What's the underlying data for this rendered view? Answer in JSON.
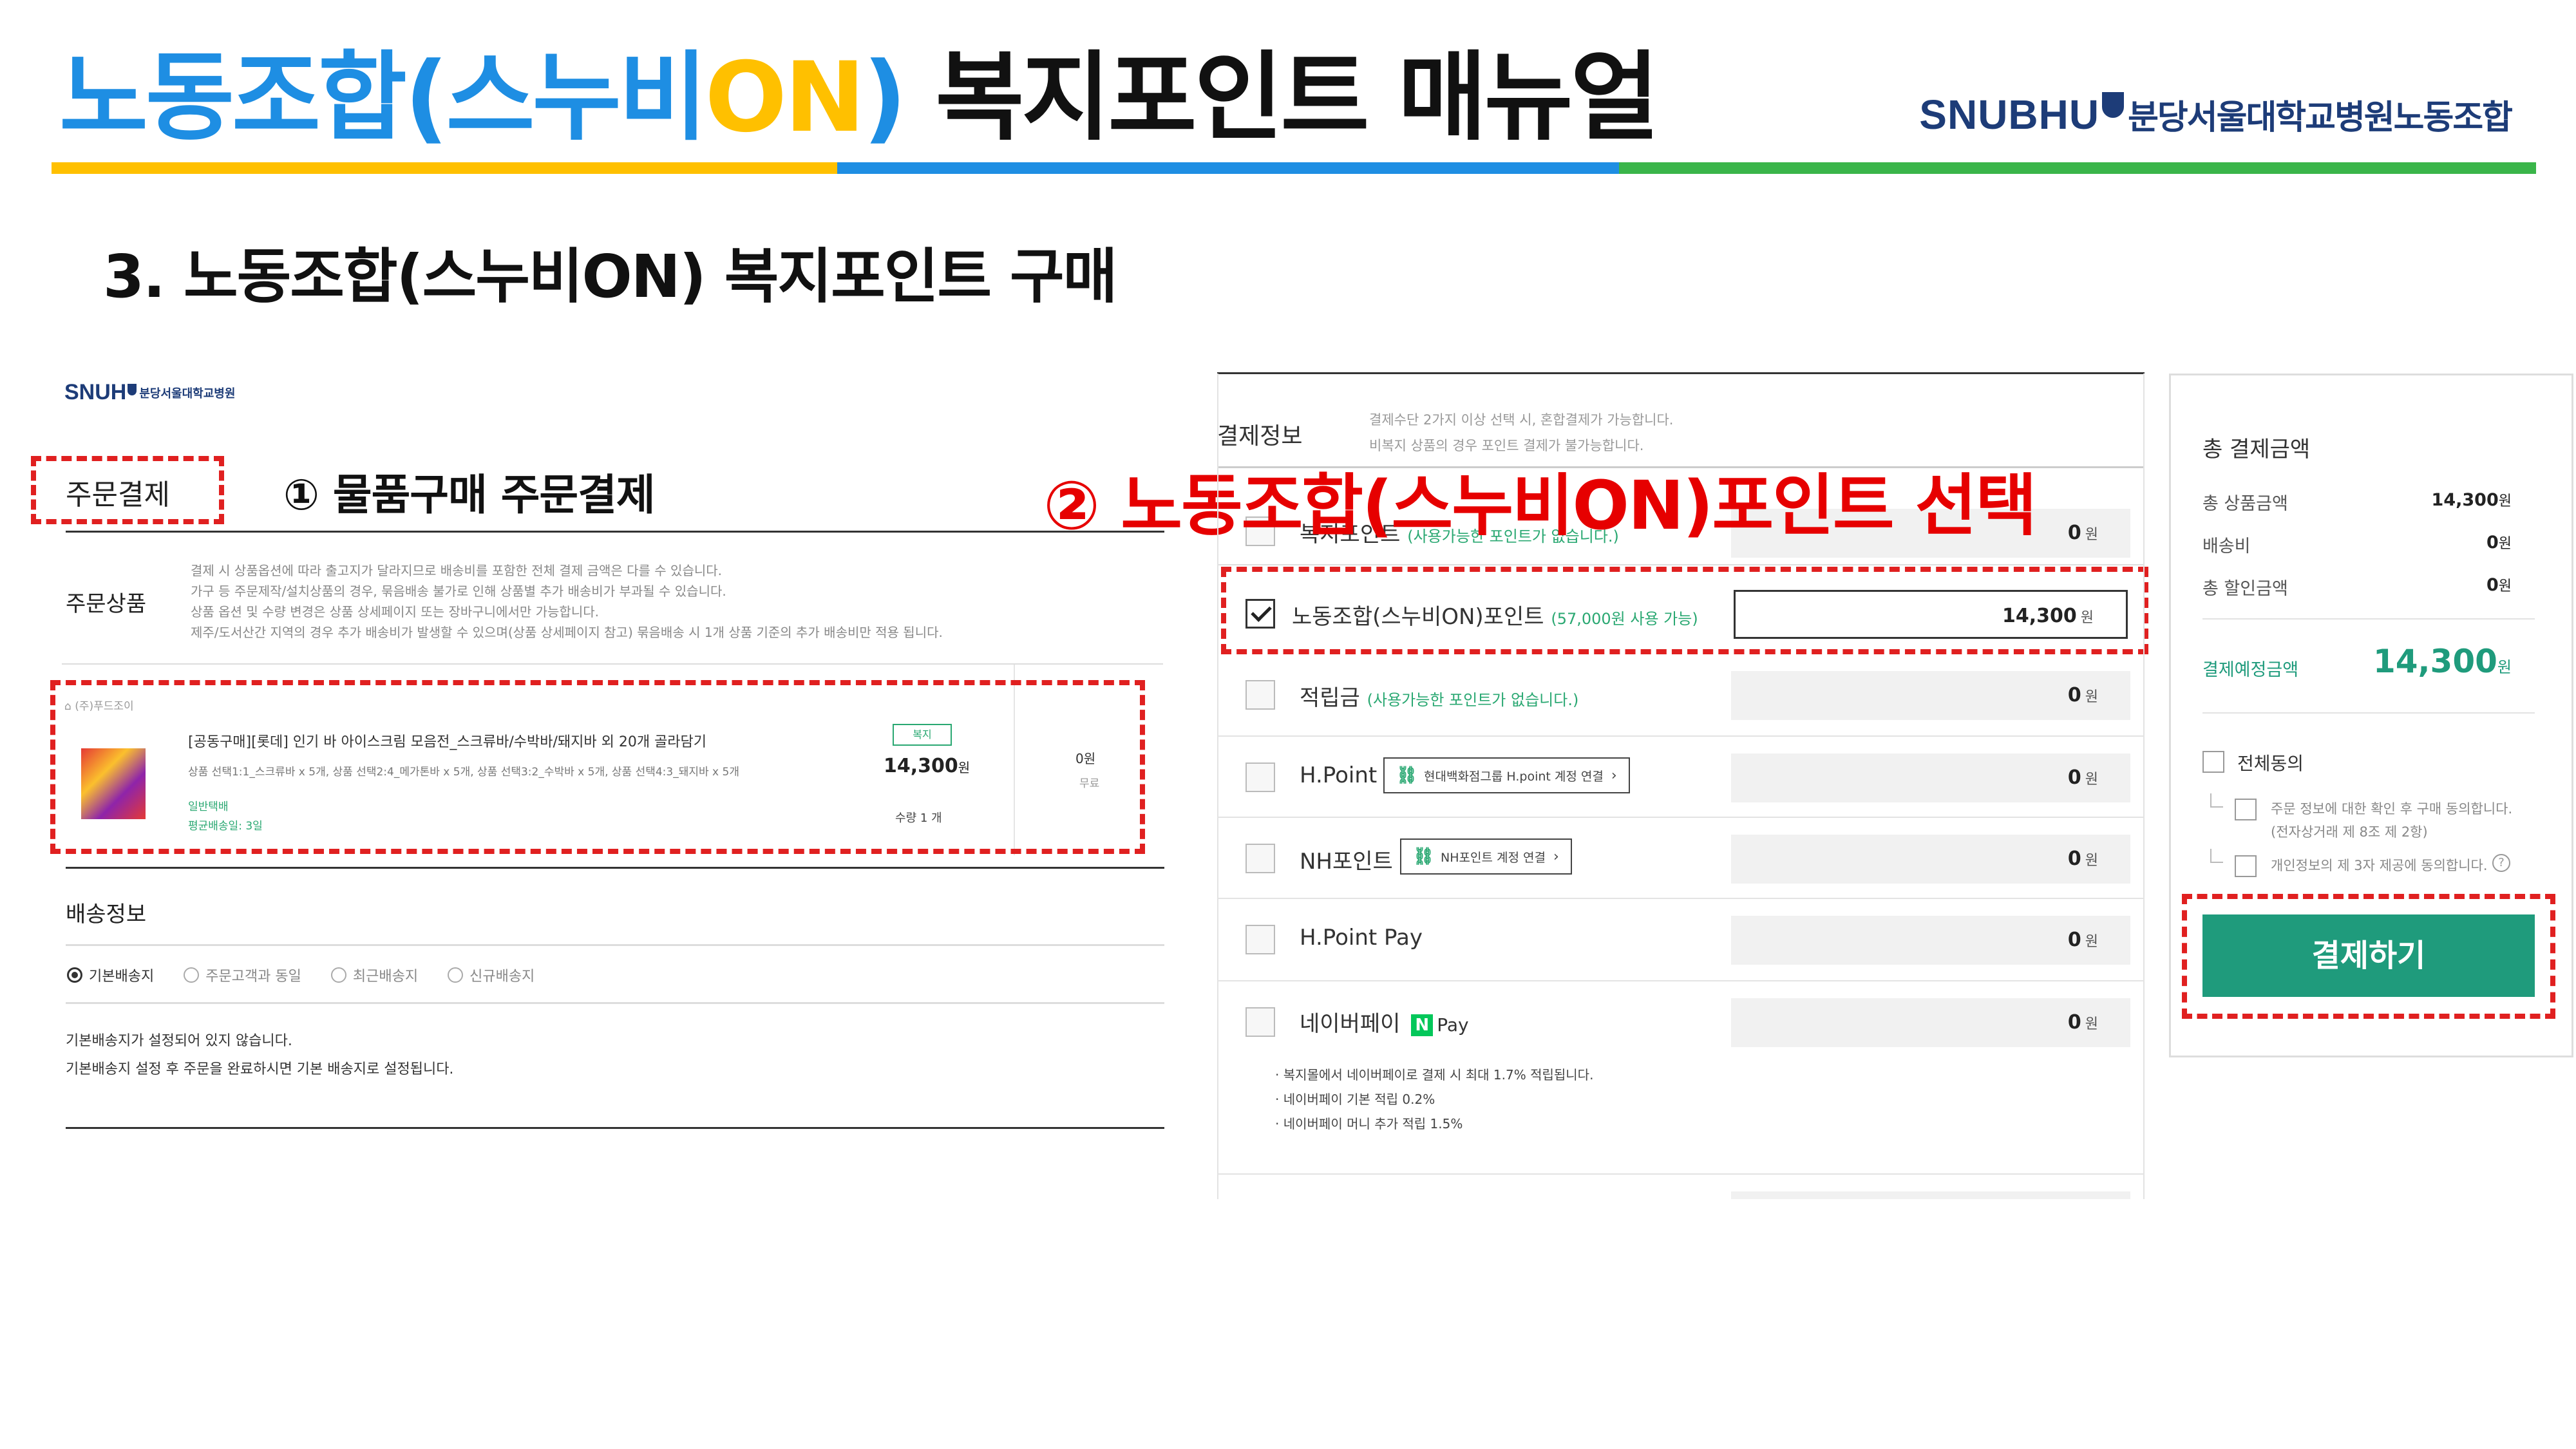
{
  "header": {
    "title_part1": "노동조합(스누비",
    "title_part2": "ON",
    "title_part3": ")",
    "title_part4": " 복지포인트 매뉴얼",
    "brand_en": "SNUBHU",
    "brand_ko": "분당서울대학교병원노동조합",
    "section": "3. 노동조합(스누비ON) 복지포인트 구매",
    "colors": {
      "blue": "#1e8ee3",
      "yellow": "#ffc000",
      "green": "#3ab54a",
      "bar_blue": "#1e8ee3"
    }
  },
  "left": {
    "logo": "SNUH",
    "logo_ko": "분당서울대학교병원",
    "order_label": "주문결제",
    "step1": "①  물품구매 주문결제",
    "order_items_label": "주문상품",
    "notices": [
      "결제 시 상품옵션에 따라 출고지가 달라지므로 배송비를 포함한 전체 결제 금액은 다를 수 있습니다.",
      "가구 등 주문제작/설치상품의 경우, 묶음배송 불가로 인해 상품별 추가 배송비가 부과될 수 있습니다.",
      "상품 옵션 및 수량 변경은 상품 상세페이지 또는 장바구니에서만 가능합니다.",
      "제주/도서산간 지역의 경우 추가 배송비가 발생할 수 있으며(상품 상세페이지 참고) 묶음배송 시 1개 상품 기준의 추가 배송비만 적용 됩니다."
    ],
    "seller": "(주)푸드조이",
    "product_name": "[공동구매][롯데] 인기 바 아이스크림 모음전_스크류바/수박바/돼지바 외 20개 골라담기",
    "product_options": "상품 선택1:1_스크류바 x 5개, 상품 선택2:4_메가톤바 x 5개, 상품 선택3:2_수박바 x 5개, 상품 선택4:3_돼지바 x 5개",
    "delivery_type": "일반택배",
    "delivery_avg": "평균배송일: 3일",
    "badge": "복지",
    "price": "14,300",
    "price_unit": "원",
    "quantity": "수량 1 개",
    "shipping_fee": "0원",
    "shipping_free": "무료",
    "delivery_info_label": "배송정보",
    "radio_options": [
      "기본배송지",
      "주문고객과 동일",
      "최근배송지",
      "신규배송지"
    ],
    "delivery_msg1": "기본배송지가 설정되어 있지 않습니다.",
    "delivery_msg2": "기본배송지 설정 후 주문을 완료하시면 기본 배송지로 설정됩니다."
  },
  "middle": {
    "pay_info_label": "결제정보",
    "pay_note1": "결제수단 2가지 이상 선택 시, 혼합결제가 가능합니다.",
    "pay_note2": "비복지 상품의 경우 포인트 결제가 불가능합니다.",
    "step2": "②  노동조합(스누비ON)포인트 선택",
    "rows": [
      {
        "label": "복지포인트",
        "sub": "(사용가능한 포인트가 없습니다.)",
        "value": "0",
        "checked": false
      },
      {
        "label": "노동조합(스누비ON)포인트",
        "sub": "(57,000원 사용 가능)",
        "value": "14,300",
        "checked": true
      },
      {
        "label": "적립금",
        "sub": "(사용가능한 포인트가 없습니다.)",
        "value": "0",
        "checked": false
      },
      {
        "label": "H.Point",
        "link": "현대백화점그룹 H.point 계정 연결",
        "value": "0",
        "checked": false
      },
      {
        "label": "NH포인트",
        "link": "NH포인트 계정 연결",
        "value": "0",
        "checked": false
      },
      {
        "label": "H.Point Pay",
        "value": "0",
        "checked": false
      },
      {
        "label": "네이버페이",
        "pay": "Pay",
        "value": "0",
        "checked": false
      }
    ],
    "unit": "원",
    "naver_notes": [
      "· 복지몰에서 네이버페이로 결제 시 최대 1.7% 적립됩니다.",
      "· 네이버페이 기본 적립 0.2%",
      "· 네이버페이 머니 추가 적립 1.5%"
    ]
  },
  "right": {
    "total_label": "총 결제금액",
    "product_amount_label": "총 상품금액",
    "product_amount": "14,300",
    "shipping_label": "배송비",
    "shipping": "0",
    "discount_label": "총 할인금액",
    "discount": "0",
    "expected_label": "결제예정금액",
    "expected": "14,300",
    "unit": "원",
    "agree_all": "전체동의",
    "agree1a": "주문 정보에 대한 확인 후 구매 동의합니다.",
    "agree1b": "(전자상거래 제 8조 제 2항)",
    "agree2": "개인정보의 제 3자 제공에 동의합니다.",
    "pay_button": "결제하기",
    "accent": "#1f9b7c"
  }
}
